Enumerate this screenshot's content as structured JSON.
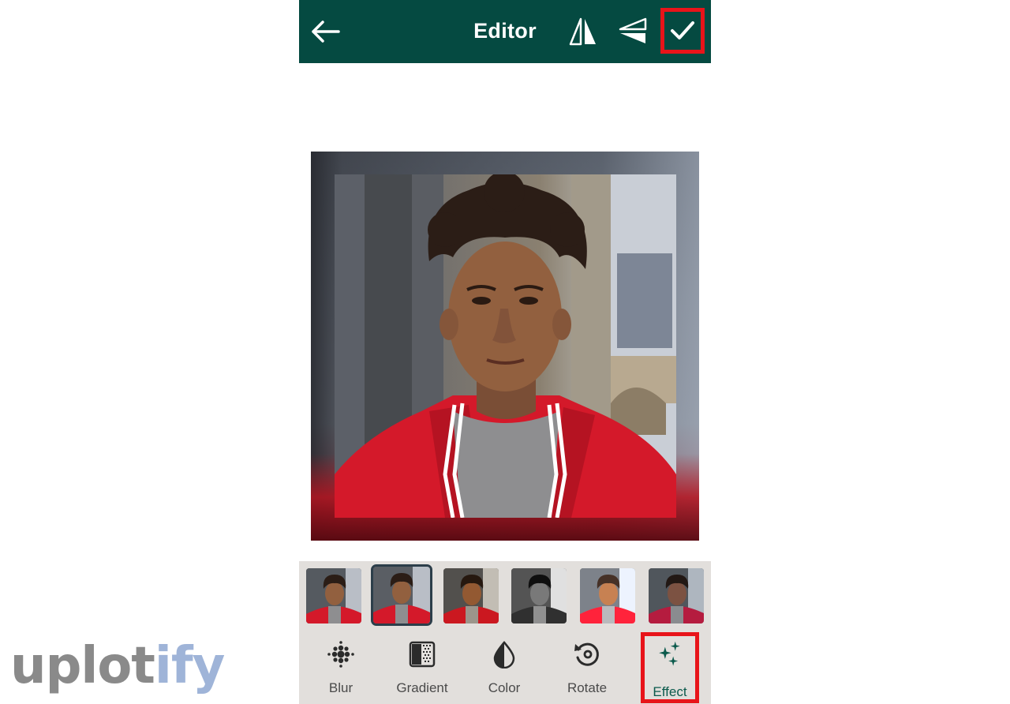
{
  "appbar": {
    "title": "Editor",
    "back_icon": "arrow-left-icon",
    "flip_horizontal_icon": "flip-horizontal-icon",
    "flip_vertical_icon": "flip-vertical-icon",
    "confirm_icon": "checkmark-icon",
    "background_color": "#054a41",
    "highlight_color": "#e8141a"
  },
  "filters": [
    {
      "name": "original"
    },
    {
      "name": "selected",
      "selected": true
    },
    {
      "name": "warm"
    },
    {
      "name": "black-white"
    },
    {
      "name": "bright"
    },
    {
      "name": "cool"
    }
  ],
  "tools": [
    {
      "label": "Blur",
      "icon": "blur-dots-icon"
    },
    {
      "label": "Gradient",
      "icon": "gradient-icon"
    },
    {
      "label": "Color",
      "icon": "contrast-drop-icon"
    },
    {
      "label": "Rotate",
      "icon": "rotate-icon"
    },
    {
      "label": "Effect",
      "icon": "sparkles-icon",
      "active": true
    }
  ],
  "watermark": {
    "part1": "uplot",
    "part2": "ify"
  }
}
